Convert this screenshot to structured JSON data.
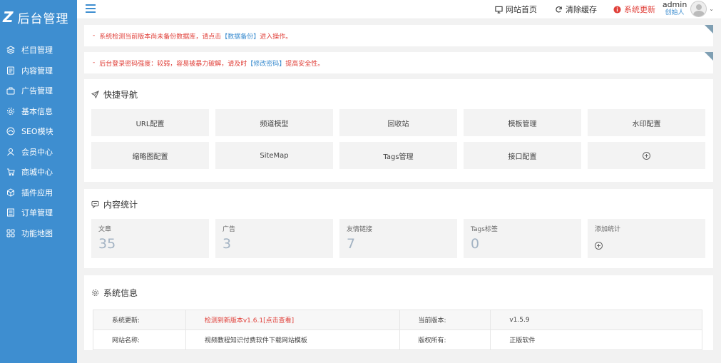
{
  "app": {
    "logo_mark": "Z",
    "logo_text": "后台管理"
  },
  "sidebar": {
    "items": [
      {
        "label": "栏目管理",
        "icon": "layers-icon"
      },
      {
        "label": "内容管理",
        "icon": "document-icon"
      },
      {
        "label": "广告管理",
        "icon": "ad-icon"
      },
      {
        "label": "基本信息",
        "icon": "gear-icon"
      },
      {
        "label": "SEO模块",
        "icon": "seo-icon"
      },
      {
        "label": "会员中心",
        "icon": "user-icon"
      },
      {
        "label": "商城中心",
        "icon": "cart-icon"
      },
      {
        "label": "插件应用",
        "icon": "plugin-icon"
      },
      {
        "label": "订单管理",
        "icon": "order-icon"
      },
      {
        "label": "功能地图",
        "icon": "grid-icon"
      }
    ]
  },
  "header": {
    "home_label": "网站首页",
    "clear_cache_label": "清除缓存",
    "update_label": "系统更新",
    "user_name": "admin",
    "user_role": "创始人"
  },
  "notices": [
    {
      "prefix": "系统检测当前版本尚未备份数据库，请点击",
      "link": "【数据备份】",
      "suffix": "进入操作。"
    },
    {
      "prefix": "后台登录密码强度：较弱，容易被暴力破解，请及时",
      "link": "【修改密码】",
      "suffix": "提高安全性。"
    }
  ],
  "quick_nav": {
    "title": "快捷导航",
    "items": [
      "URL配置",
      "频道模型",
      "回收站",
      "模板管理",
      "水印配置",
      "缩略图配置",
      "SiteMap",
      "Tags管理",
      "接口配置"
    ]
  },
  "stats": {
    "title": "内容统计",
    "items": [
      {
        "label": "文章",
        "value": "35"
      },
      {
        "label": "广告",
        "value": "3"
      },
      {
        "label": "友情链接",
        "value": "7"
      },
      {
        "label": "Tags标签",
        "value": "0"
      }
    ],
    "add_label": "添加统计"
  },
  "system": {
    "title": "系统信息",
    "rows": [
      {
        "k1": "系统更新:",
        "v1": "检测到新版本v1.6.1[点击查看]",
        "k2": "当前版本:",
        "v2": "v1.5.9"
      },
      {
        "k1": "网站名称:",
        "v1": "视频教程知识付费软件下载网站模板",
        "k2": "版权所有:",
        "v2": "正版软件"
      }
    ]
  },
  "colors": {
    "sidebar": "#3e8ed0",
    "alert": "#e0403a",
    "stat_value": "#a3b3c3"
  }
}
